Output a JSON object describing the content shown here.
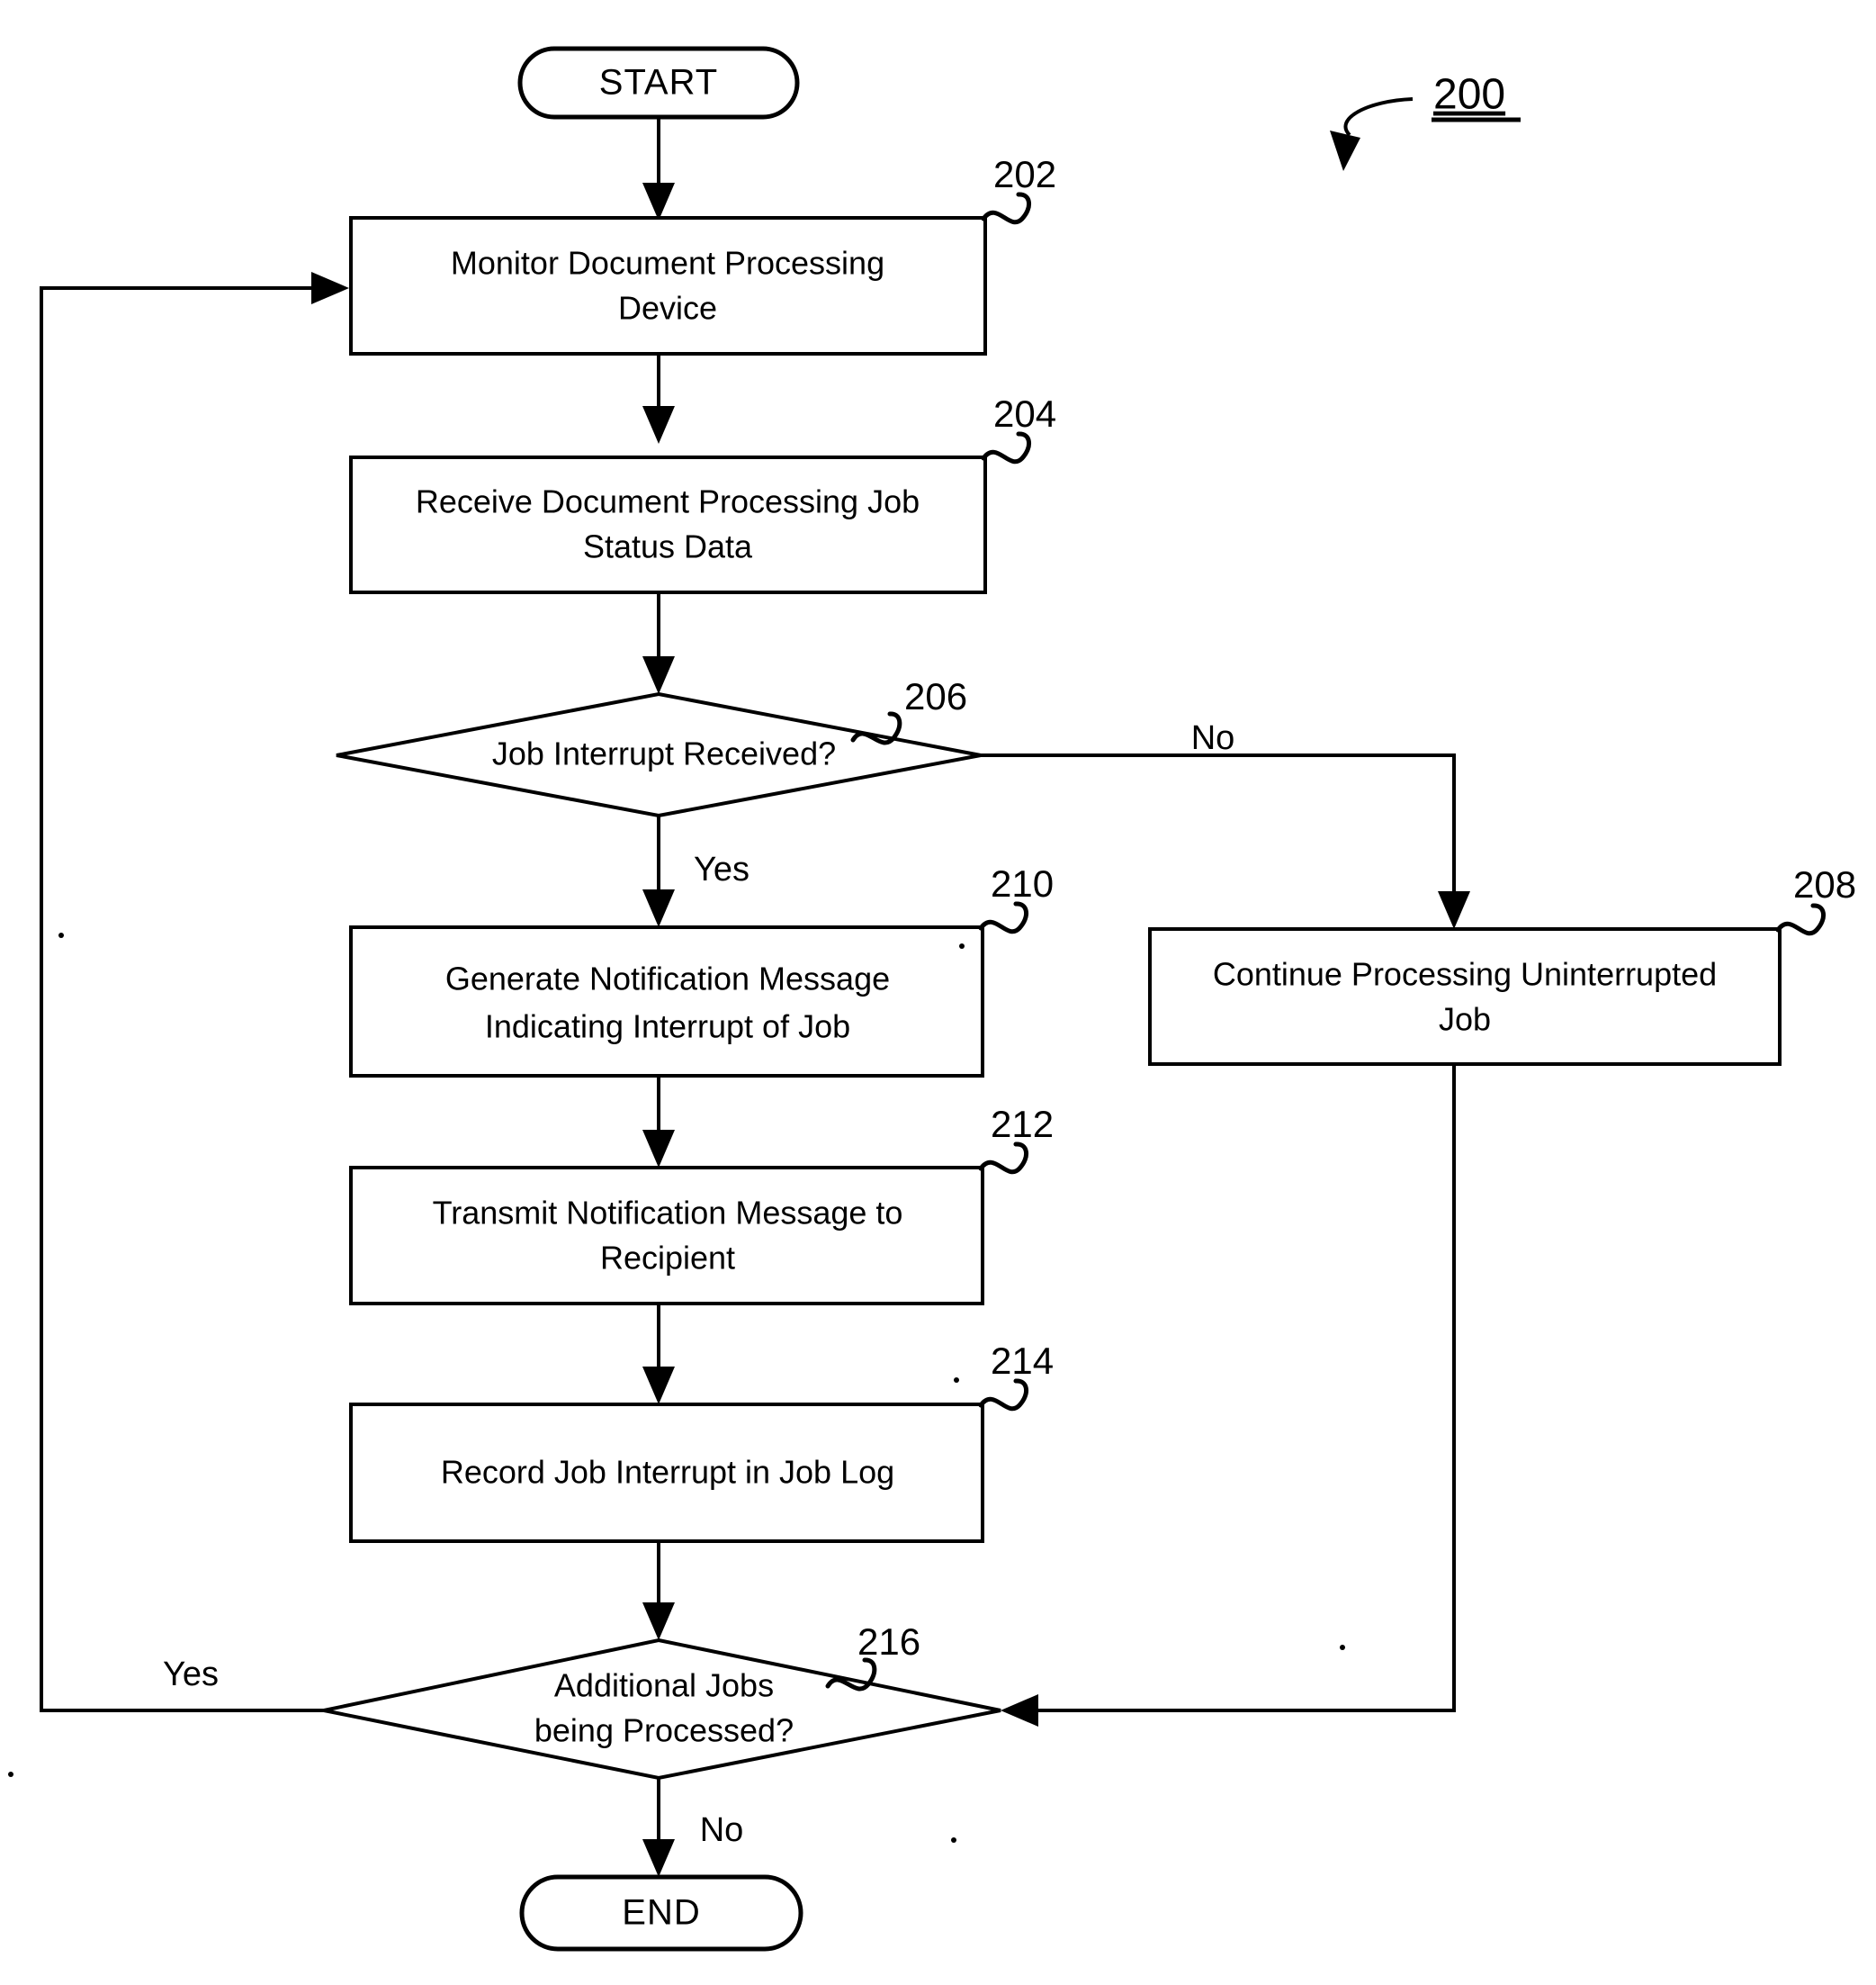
{
  "figure": {
    "number": "200",
    "type": "flowchart"
  },
  "nodes": {
    "start": {
      "label": "START",
      "ref": ""
    },
    "n202": {
      "line1": "Monitor Document Processing",
      "line2": "Device",
      "ref": "202"
    },
    "n204": {
      "line1": "Receive Document Processing Job",
      "line2": "Status Data",
      "ref": "204"
    },
    "n206": {
      "line1": "Job Interrupt Received?",
      "line2": "",
      "ref": "206"
    },
    "n208": {
      "line1": "Continue Processing Uninterrupted",
      "line2": "Job",
      "ref": "208"
    },
    "n210": {
      "line1": "Generate Notification Message",
      "line2": "Indicating Interrupt of Job",
      "ref": "210"
    },
    "n212": {
      "line1": "Transmit Notification Message to",
      "line2": "Recipient",
      "ref": "212"
    },
    "n214": {
      "line1": "Record Job Interrupt in Job Log",
      "line2": "",
      "ref": "214"
    },
    "n216": {
      "line1": "Additional Jobs",
      "line2": "being Processed?",
      "ref": "216"
    },
    "end": {
      "label": "END",
      "ref": ""
    }
  },
  "edge_labels": {
    "d206_no": "No",
    "d206_yes": "Yes",
    "d216_yes": "Yes",
    "d216_no": "No"
  },
  "colors": {
    "line": "#000000",
    "fill": "#ffffff"
  }
}
